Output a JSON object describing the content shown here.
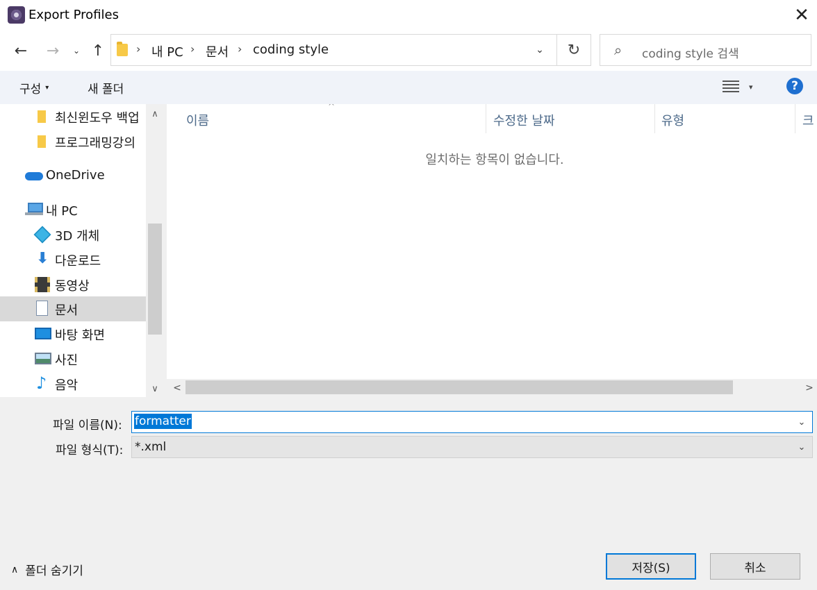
{
  "window": {
    "title": "Export Profiles",
    "close_glyph": "✕",
    "app_icon": "eclipse-app-icon"
  },
  "nav": {
    "back_glyph": "←",
    "forward_glyph": "→",
    "recent_glyph": "⌄",
    "up_glyph": "↑",
    "breadcrumbs": [
      "내 PC",
      "문서",
      "coding style"
    ],
    "crumb_separator": "›",
    "dropdown_glyph": "⌄",
    "refresh_glyph": "↻",
    "search_placeholder": "coding style 검색",
    "search_glyph": "⌕"
  },
  "toolbar": {
    "organize_label": "구성",
    "organize_caret": "▾",
    "new_folder_label": "새 폴더",
    "view_caret": "▾",
    "help_label": "?"
  },
  "sidebar": {
    "scroll_up_glyph": "∧",
    "scroll_down_glyph": "∨",
    "items": [
      {
        "label": "최신윈도우 백업",
        "icon": "folder-icon",
        "selected": false
      },
      {
        "label": "프로그래밍강의",
        "icon": "folder-icon",
        "selected": false
      },
      {
        "label": "OneDrive",
        "icon": "cloud-icon",
        "selected": false
      },
      {
        "label": "내 PC",
        "icon": "computer-icon",
        "selected": false
      },
      {
        "label": "3D 개체",
        "icon": "cube-icon",
        "selected": false
      },
      {
        "label": "다운로드",
        "icon": "download-icon",
        "selected": false
      },
      {
        "label": "동영상",
        "icon": "video-icon",
        "selected": false
      },
      {
        "label": "문서",
        "icon": "document-icon",
        "selected": true
      },
      {
        "label": "바탕 화면",
        "icon": "desktop-icon",
        "selected": false
      },
      {
        "label": "사진",
        "icon": "pictures-icon",
        "selected": false
      },
      {
        "label": "음악",
        "icon": "music-icon",
        "selected": false
      }
    ]
  },
  "filelist": {
    "sort_glyph": "^",
    "columns": [
      "이름",
      "수정한 날짜",
      "유형",
      "크"
    ],
    "empty_message": "일치하는 항목이 없습니다.",
    "hscroll_left_glyph": "<",
    "hscroll_right_glyph": ">"
  },
  "form": {
    "filename_label": "파일 이름(N):",
    "filename_value": "formatter",
    "filetype_label": "파일 형식(T):",
    "filetype_value": "*.xml",
    "dropdown_glyph": "⌄"
  },
  "footer": {
    "hide_folders_label": "폴더 숨기기",
    "hide_glyph": "∧",
    "save_label": "저장(S)",
    "cancel_label": "취소"
  },
  "colors": {
    "accent": "#0078d7",
    "help": "#1e6fd0",
    "selected_row": "#d9d9d9"
  }
}
